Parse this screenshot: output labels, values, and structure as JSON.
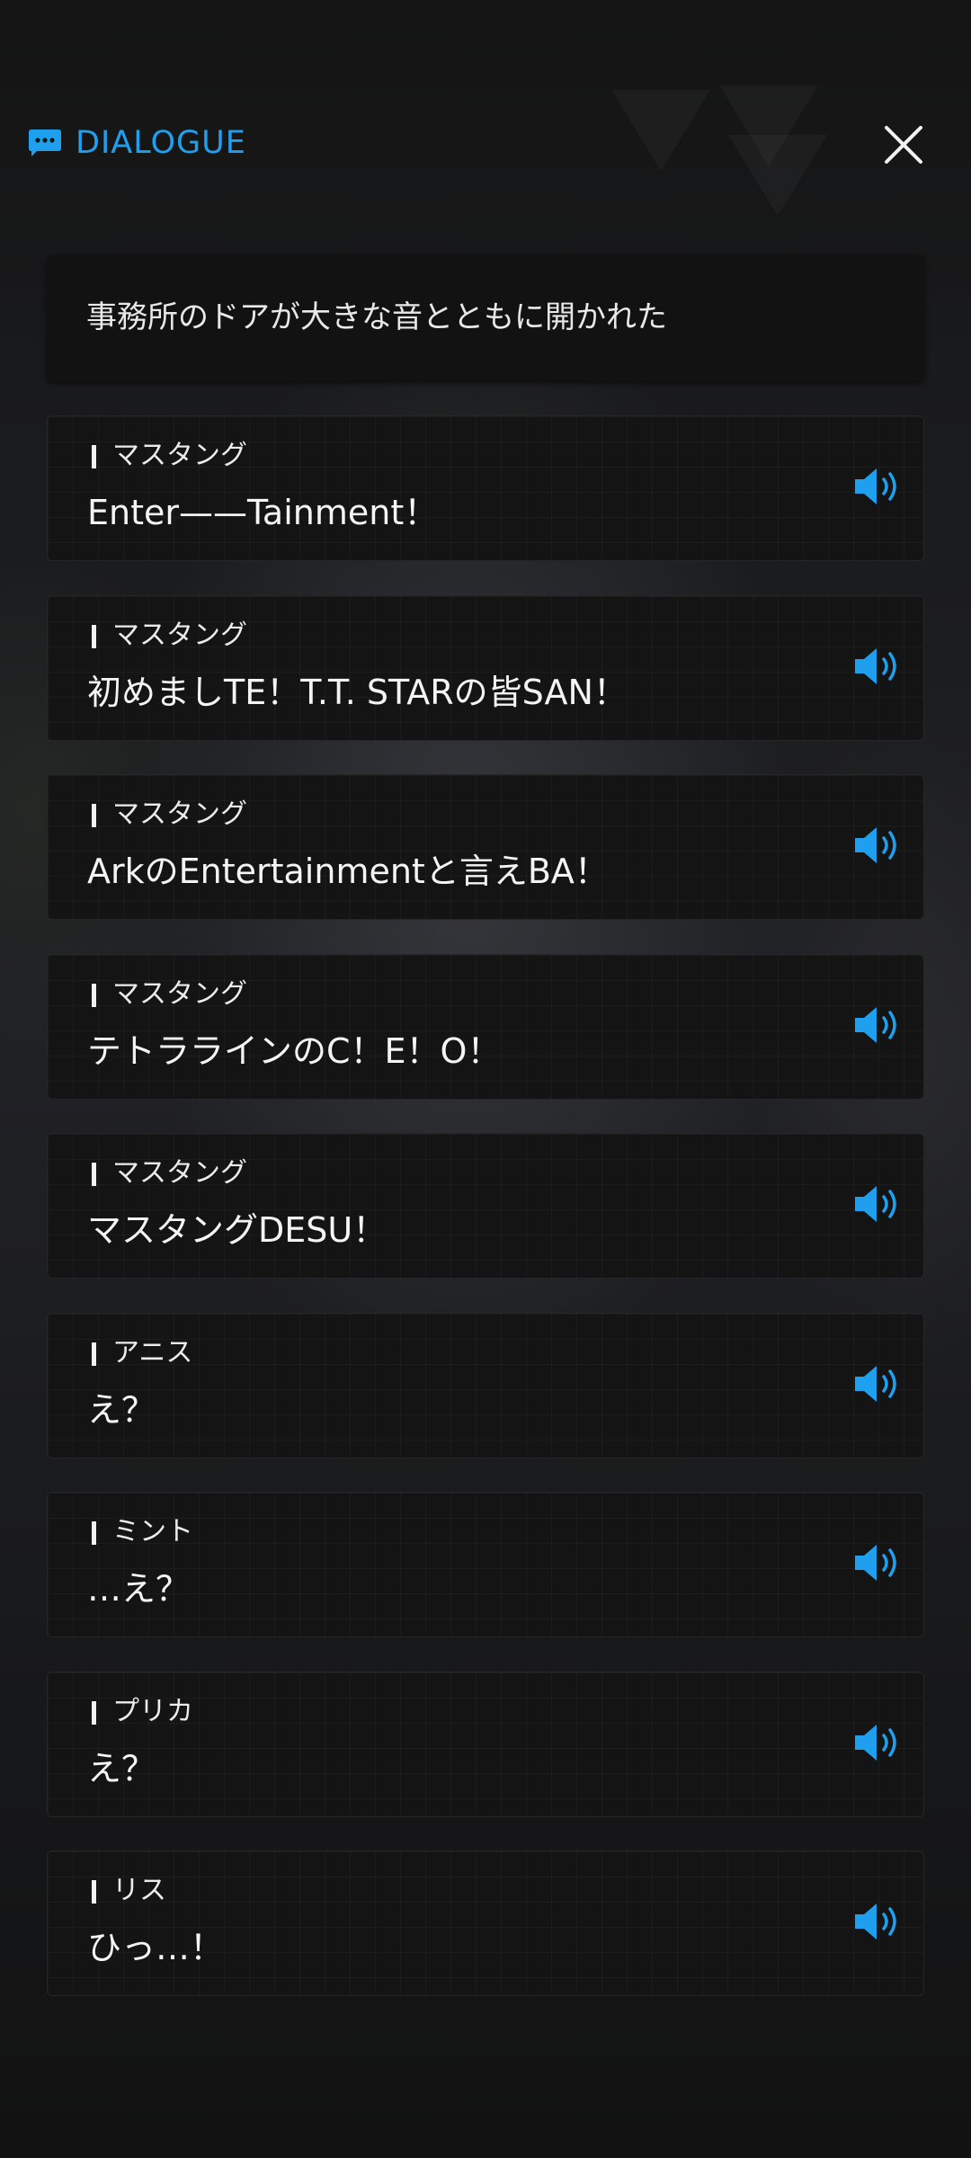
{
  "header": {
    "title": "DIALOGUE",
    "icon": "chat-bubble-icon",
    "close_icon": "close-icon"
  },
  "colors": {
    "accent": "#1fa0ee",
    "card_bg": "#141414",
    "text": "#f4f4f4"
  },
  "narration": "事務所のドアが大きな音とともに開かれた",
  "lines": [
    {
      "speaker": "マスタング",
      "text": "Enter——Tainment！",
      "icon": "speaker-icon"
    },
    {
      "speaker": "マスタング",
      "text": "初めましTE！T.T. STARの皆SAN！",
      "icon": "speaker-icon"
    },
    {
      "speaker": "マスタング",
      "text": "ArkのEntertainmentと言えBA！",
      "icon": "speaker-icon"
    },
    {
      "speaker": "マスタング",
      "text": "テトララインのC！E！O！",
      "icon": "speaker-icon"
    },
    {
      "speaker": "マスタング",
      "text": "マスタングDESU！",
      "icon": "speaker-icon"
    },
    {
      "speaker": "アニス",
      "text": "え？",
      "icon": "speaker-icon"
    },
    {
      "speaker": "ミント",
      "text": "…え？",
      "icon": "speaker-icon"
    },
    {
      "speaker": "プリカ",
      "text": "え？",
      "icon": "speaker-icon"
    },
    {
      "speaker": "リス",
      "text": "ひっ…！",
      "icon": "speaker-icon"
    }
  ]
}
